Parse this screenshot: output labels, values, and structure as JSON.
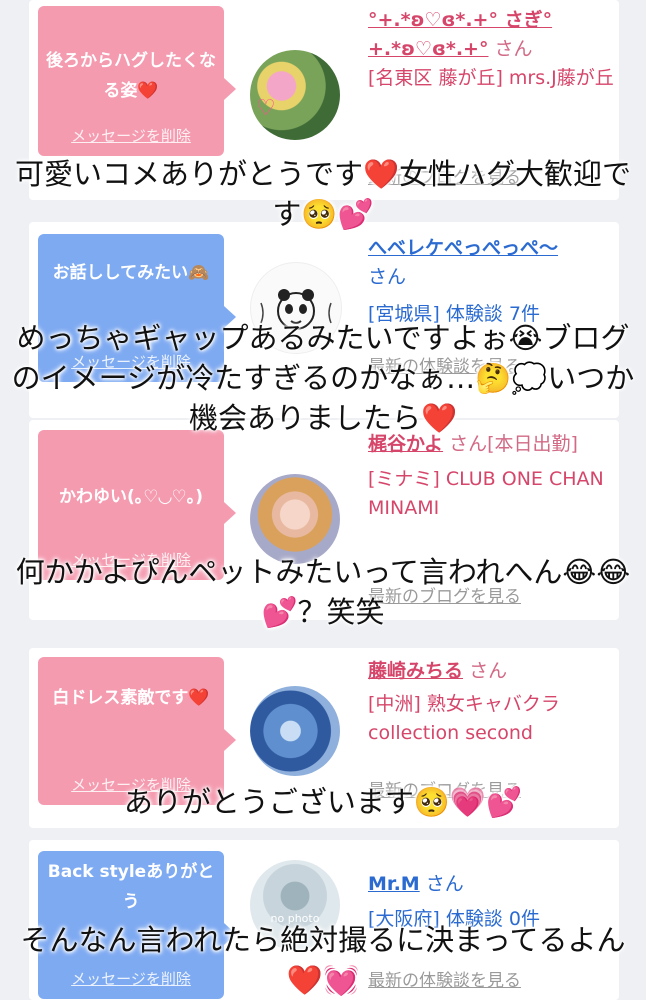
{
  "cards": [
    {
      "message": "後ろからハグしたくなる姿❤️",
      "delete_label": "メッセージを削除",
      "name": "°+.*ʚ♡ɞ*.+° さぎ°+.*ʚ♡ɞ*.+°",
      "san": "さん",
      "detail": "[名東区 藤が丘] mrs.J藤が丘",
      "latest": "最新のブログを見る"
    },
    {
      "message": "お話ししてみたい🙈",
      "delete_label": "メッセージを削除",
      "name": "へベレケぺっぺっぺ〜",
      "san": "さん",
      "detail": "[宮城県] 体験談 7件",
      "latest": "最新の体験談を見る"
    },
    {
      "message": "かわゆい(｡♡◡♡｡)",
      "delete_label": "メッセージを削除",
      "name": "梶谷かよ",
      "san": "さん[本日出勤]",
      "detail": "[ミナミ] CLUB ONE CHAN MINAMI",
      "latest": "最新のブログを見る"
    },
    {
      "message": "白ドレス素敵です❤️",
      "delete_label": "メッセージを削除",
      "name": "藤崎みちる",
      "san": "さん",
      "detail": "[中洲] 熟女キャバクラ collection second",
      "latest": "最新のブログを見る"
    },
    {
      "message": "Back styleありがとう",
      "delete_label": "メッセージを削除",
      "name": "Mr.M",
      "san": "さん",
      "detail": "[大阪府] 体験談 0件",
      "latest": "最新の体験談を見る",
      "avatar_text": "no photo"
    }
  ],
  "overlays": [
    "可愛いコメありがとうです❤️女性ハグ大歓迎です🥺💕",
    "めっちゃギャップあるみたいですよぉ😭ブログのイメージが冷たすぎるのかなぁ…🤔💭いつか機会ありましたら❤️",
    "何かかよぴんペットみたいって言われへん😂😂💕？笑笑",
    "ありがとうございます🥺💗💕",
    "そんなん言われたら絶対撮るに決まってるよん❤️💓"
  ],
  "colors": {
    "pink_bubble": "#f59bb0",
    "blue_bubble": "#7eaaf2",
    "name_pink": "#d6466a",
    "name_blue": "#2b6bd1"
  }
}
